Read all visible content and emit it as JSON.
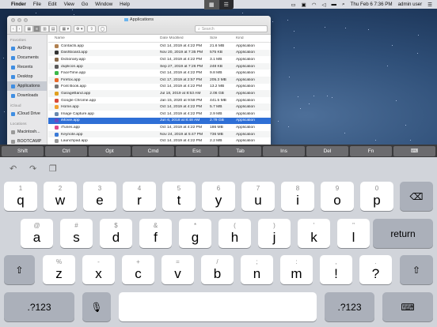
{
  "menubar": {
    "apple_glyph": "",
    "items": [
      "Finder",
      "File",
      "Edit",
      "View",
      "Go",
      "Window",
      "Help"
    ],
    "clock": "Thu Feb 6  7:36 PM",
    "user": "admin user",
    "mode_toggle": {
      "left_glyph": "▦",
      "right_glyph": "☰"
    }
  },
  "finder": {
    "title": "Applications",
    "search_placeholder": "Search",
    "toolbar": {
      "back": "‹",
      "forward": "›",
      "views": [
        "▦",
        "≡",
        "▥",
        "▤"
      ],
      "arrange": "▦ ▾",
      "action": "⚙ ▾",
      "share": "⇧",
      "tag": "◯"
    },
    "sidebar": {
      "favorites_header": "Favorites",
      "favorites": [
        "AirDrop",
        "Documents",
        "Recents",
        "Desktop",
        "Applications",
        "Downloads"
      ],
      "selected": "Applications",
      "icloud_header": "iCloud",
      "icloud": [
        "iCloud Drive"
      ],
      "locations_header": "Locations",
      "locations": [
        "Macintosh...",
        "BOOTCAMP"
      ]
    },
    "columns": {
      "name": "Name",
      "date": "Date Modified",
      "size": "Size",
      "kind": "Kind"
    },
    "files": [
      {
        "name": "Contacts.app",
        "date": "Oct 14, 2019 at 4:22 PM",
        "size": "21.6 MB",
        "kind": "Application",
        "color": "#b08050"
      },
      {
        "name": "Dashboard.app",
        "date": "Nov 20, 2019 at 7:35 PM",
        "size": "575 KB",
        "kind": "Application",
        "color": "#333333"
      },
      {
        "name": "Dictionary.app",
        "date": "Oct 14, 2019 at 4:22 PM",
        "size": "3.1 MB",
        "kind": "Application",
        "color": "#8a6a4a"
      },
      {
        "name": "duplicon.app",
        "date": "Sep 27, 2019 at 7:26 PM",
        "size": "248 KB",
        "kind": "Application",
        "color": "#5a5a5a"
      },
      {
        "name": "FaceTime.app",
        "date": "Oct 14, 2019 at 4:22 PM",
        "size": "9.8 MB",
        "kind": "Application",
        "color": "#3cb84a"
      },
      {
        "name": "Firefox.app",
        "date": "Oct 17, 2019 at 2:57 PM",
        "size": "205.3 MB",
        "kind": "Application",
        "color": "#e8692a"
      },
      {
        "name": "Font Book.app",
        "date": "Oct 14, 2019 at 4:22 PM",
        "size": "13.2 MB",
        "kind": "Application",
        "color": "#777777"
      },
      {
        "name": "GarageBand.app",
        "date": "Jul 18, 2019 at 8:53 AM",
        "size": "2.06 GB",
        "kind": "Application",
        "color": "#e0a020"
      },
      {
        "name": "Google Chrome.app",
        "date": "Jan 15, 2020 at 9:58 PM",
        "size": "441.5 MB",
        "kind": "Application",
        "color": "#d94a3a"
      },
      {
        "name": "Home.app",
        "date": "Oct 14, 2019 at 4:22 PM",
        "size": "5.7 MB",
        "kind": "Application",
        "color": "#f0a030"
      },
      {
        "name": "Image Capture.app",
        "date": "Oct 14, 2019 at 4:22 PM",
        "size": "2.9 MB",
        "kind": "Application",
        "color": "#6a8ab0"
      },
      {
        "name": "iMovie.app",
        "date": "Jun 6, 2018 at 8:48 AM",
        "size": "2.79 GB",
        "kind": "Application",
        "color": "#6a4ac0",
        "selected": true
      },
      {
        "name": "iTunes.app",
        "date": "Oct 14, 2019 at 4:22 PM",
        "size": "186 MB",
        "kind": "Application",
        "color": "#e04a8a"
      },
      {
        "name": "Keynote.app",
        "date": "Nov 24, 2019 at 5:47 PM",
        "size": "736 MB",
        "kind": "Application",
        "color": "#3a7ad8"
      },
      {
        "name": "Launchpad.app",
        "date": "Oct 14, 2019 at 4:22 PM",
        "size": "2.2 MB",
        "kind": "Application",
        "color": "#999999"
      }
    ]
  },
  "modifier_bar": [
    "Shift",
    "Ctrl",
    "Opt",
    "Cmd",
    "Esc",
    "Tab",
    "Ins",
    "Del",
    "Fn",
    "⌨"
  ],
  "keyboard": {
    "toolbar": {
      "undo": "↶",
      "redo": "↷",
      "paste": "❐"
    },
    "row1": [
      {
        "main": "q",
        "sub": "1"
      },
      {
        "main": "w",
        "sub": "2"
      },
      {
        "main": "e",
        "sub": "3"
      },
      {
        "main": "r",
        "sub": "4"
      },
      {
        "main": "t",
        "sub": "5"
      },
      {
        "main": "y",
        "sub": "6"
      },
      {
        "main": "u",
        "sub": "7"
      },
      {
        "main": "i",
        "sub": "8"
      },
      {
        "main": "o",
        "sub": "9"
      },
      {
        "main": "p",
        "sub": "0"
      }
    ],
    "row2": [
      {
        "main": "a",
        "sub": "@"
      },
      {
        "main": "s",
        "sub": "#"
      },
      {
        "main": "d",
        "sub": "$"
      },
      {
        "main": "f",
        "sub": "&"
      },
      {
        "main": "g",
        "sub": "*"
      },
      {
        "main": "h",
        "sub": "("
      },
      {
        "main": "j",
        "sub": ")"
      },
      {
        "main": "k",
        "sub": "'"
      },
      {
        "main": "l",
        "sub": "\""
      }
    ],
    "row3": [
      {
        "main": "z",
        "sub": "%"
      },
      {
        "main": "x",
        "sub": "-"
      },
      {
        "main": "c",
        "sub": "+"
      },
      {
        "main": "v",
        "sub": "="
      },
      {
        "main": "b",
        "sub": "/"
      },
      {
        "main": "n",
        "sub": ";"
      },
      {
        "main": "m",
        "sub": ":"
      },
      {
        "main": "!",
        "sub": ","
      },
      {
        "main": "?",
        "sub": "."
      }
    ],
    "backspace": "⌫",
    "return": "return",
    "shift": "⇧",
    "numbers": ".?123",
    "mic": "🎙",
    "hide": "⌨"
  }
}
